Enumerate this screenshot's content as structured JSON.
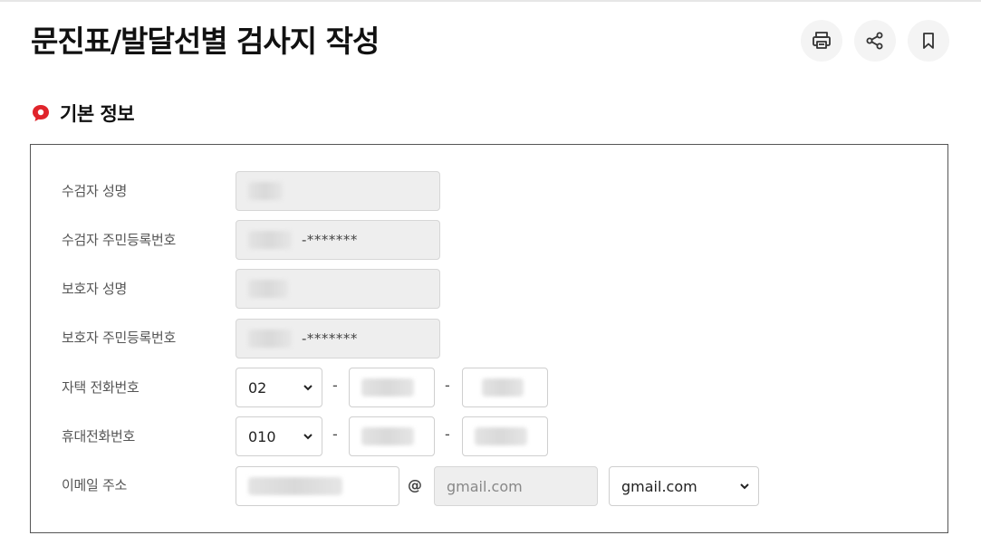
{
  "page": {
    "title": "문진표/발달선별 검사지 작성"
  },
  "actions": {
    "print_icon": "print-icon",
    "share_icon": "share-icon",
    "bookmark_icon": "bookmark-icon"
  },
  "section": {
    "title": "기본 정보",
    "icon": "speech-bubble-icon",
    "accent": "#e0242b"
  },
  "form": {
    "examinee_name": {
      "label": "수검자 성명"
    },
    "examinee_rrn": {
      "label": "수검자 주민등록번호",
      "masked": "-*******"
    },
    "guardian_name": {
      "label": "보호자 성명"
    },
    "guardian_rrn": {
      "label": "보호자 주민등록번호",
      "masked": "-*******"
    },
    "home_phone": {
      "label": "자택 전화번호",
      "area_code": "02",
      "separator": "-"
    },
    "mobile_phone": {
      "label": "휴대전화번호",
      "prefix": "010",
      "separator": "-"
    },
    "email": {
      "label": "이메일 주소",
      "at": "@",
      "domain_value": "gmail.com",
      "domain_select": "gmail.com"
    }
  }
}
